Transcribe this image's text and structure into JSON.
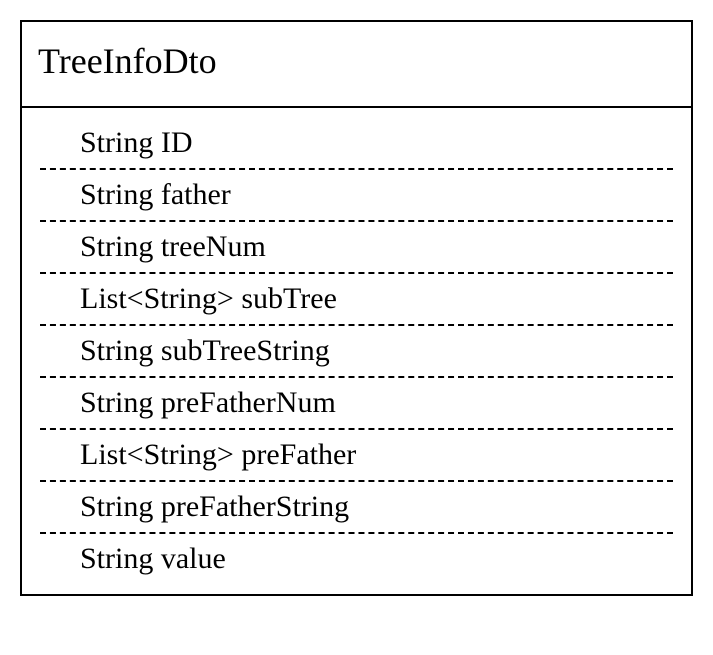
{
  "class": {
    "title": "TreeInfoDto",
    "fields": [
      "String ID",
      "String father",
      "String treeNum",
      "List<String> subTree",
      "String subTreeString",
      "String preFatherNum",
      "List<String> preFather",
      "String preFatherString",
      "String value"
    ]
  }
}
